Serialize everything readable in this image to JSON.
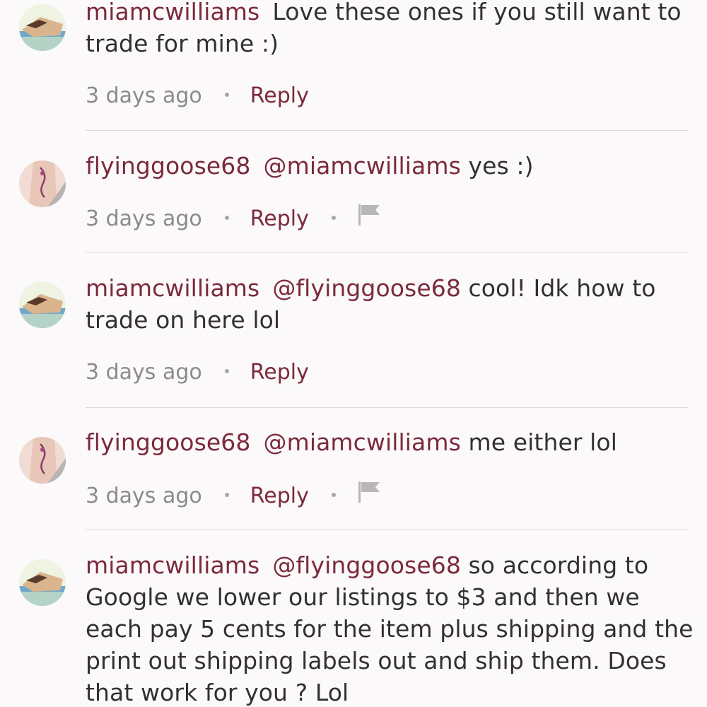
{
  "comments": [
    {
      "username": "miamcwilliams",
      "mention": "",
      "text": "Love these ones if you still want to trade for mine :)",
      "time": "3 days ago",
      "reply_label": "Reply",
      "has_flag": false,
      "avatar": "beach-photo"
    },
    {
      "username": "flyinggoose68",
      "mention": "@miamcwilliams",
      "text": "yes :)",
      "time": "3 days ago",
      "reply_label": "Reply",
      "has_flag": true,
      "avatar": "tattoo-photo"
    },
    {
      "username": "miamcwilliams",
      "mention": "@flyinggoose68",
      "text": "cool! Idk how to trade on here lol",
      "time": "3 days ago",
      "reply_label": "Reply",
      "has_flag": false,
      "avatar": "beach-photo"
    },
    {
      "username": "flyinggoose68",
      "mention": "@miamcwilliams",
      "text": "me either lol",
      "time": "3 days ago",
      "reply_label": "Reply",
      "has_flag": true,
      "avatar": "tattoo-photo"
    },
    {
      "username": "miamcwilliams",
      "mention": "@flyinggoose68",
      "text": "so according to Google we lower our listings to $3 and then we each pay 5 cents for the item plus shipping and the print out shipping labels out and ship them. Does that work for you ? Lol",
      "time": "",
      "reply_label": "",
      "has_flag": false,
      "avatar": "beach-photo"
    }
  ],
  "colors": {
    "accent": "#7b2a3d",
    "text": "#333031",
    "muted": "#8c8a8b",
    "divider": "#dcdadb",
    "background": "#fbf9f9"
  },
  "icons": {
    "flag": "flag-icon"
  }
}
